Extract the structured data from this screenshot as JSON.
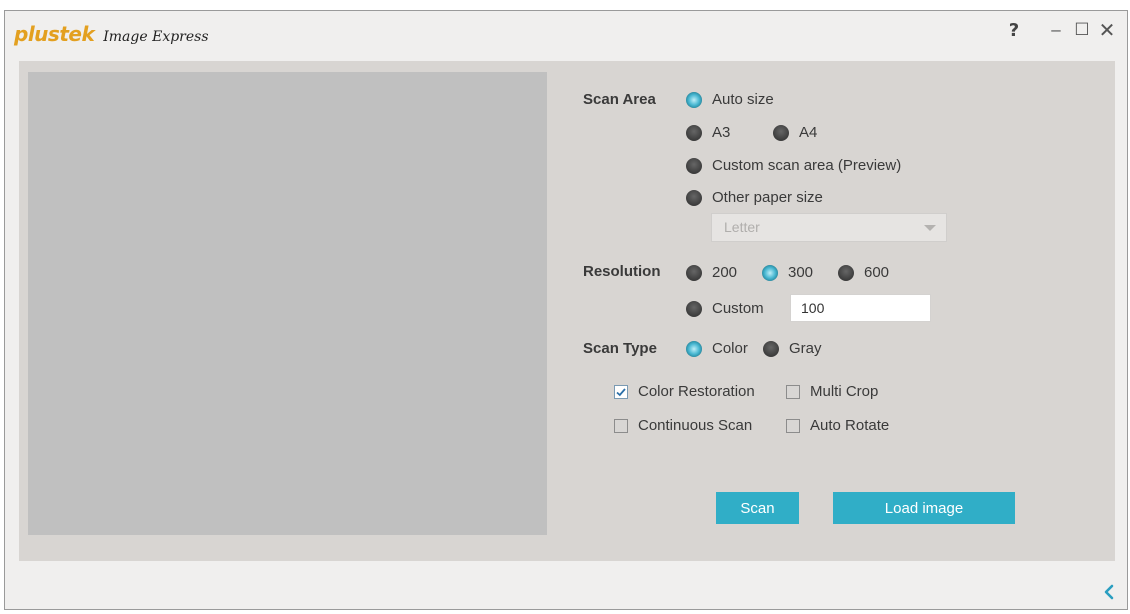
{
  "titlebar": {
    "logo": "plustek",
    "title": "Image Express",
    "help": "?",
    "minimize": "–",
    "maximize": "☐",
    "close": "✕"
  },
  "scan_area": {
    "label": "Scan Area",
    "options": [
      "Auto size",
      "A3",
      "A4",
      "Custom scan area (Preview)",
      "Other paper size"
    ],
    "selected": "Auto size",
    "paper_size": "Letter"
  },
  "resolution": {
    "label": "Resolution",
    "options": [
      "200",
      "300",
      "600",
      "Custom"
    ],
    "selected": "300",
    "custom_value": "100"
  },
  "scan_type": {
    "label": "Scan Type",
    "options": [
      "Color",
      "Gray"
    ],
    "selected": "Color"
  },
  "checkboxes": {
    "color_restoration": {
      "label": "Color Restoration",
      "checked": true
    },
    "multi_crop": {
      "label": "Multi Crop",
      "checked": false
    },
    "continuous_scan": {
      "label": "Continuous Scan",
      "checked": false
    },
    "auto_rotate": {
      "label": "Auto Rotate",
      "checked": false
    }
  },
  "buttons": {
    "scan": "Scan",
    "load_image": "Load image"
  },
  "colors": {
    "accent": "#30aec7",
    "brand": "#e3a020",
    "panel": "#d8d5d2",
    "preview": "#c0c0c0"
  }
}
